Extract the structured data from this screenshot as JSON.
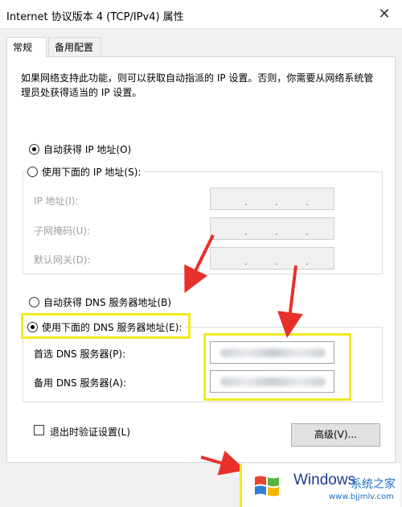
{
  "window": {
    "title": "Internet 协议版本 4 (TCP/IPv4) 属性",
    "close_symbol": "✕"
  },
  "tabs": [
    {
      "label": "常规",
      "active": true
    },
    {
      "label": "备用配置",
      "active": false
    }
  ],
  "description": "如果网络支持此功能，则可以获取自动指派的 IP 设置。否则，你需要从网络系统管理员处获得适当的 IP 设置。",
  "ip": {
    "auto_label": "自动获得 IP 地址(O)",
    "manual_label": "使用下面的 IP 地址(S):",
    "fields": [
      {
        "label": "IP 地址(I):"
      },
      {
        "label": "子网掩码(U):"
      },
      {
        "label": "默认网关(D):"
      }
    ],
    "dots": "."
  },
  "dns": {
    "auto_label": "自动获得 DNS 服务器地址(B)",
    "manual_label": "使用下面的 DNS 服务器地址(E):",
    "preferred_label": "首选 DNS 服务器(P):",
    "alternate_label": "备用 DNS 服务器(A):"
  },
  "validate_label": "退出时验证设置(L)",
  "advanced_label": "高级(V)...",
  "watermark": {
    "brand": "Windows",
    "sub": "系统之家",
    "url": "www.bjjmlv.com"
  },
  "colors": {
    "highlight": "#f2ea1e",
    "arrow": "#e8302a"
  }
}
